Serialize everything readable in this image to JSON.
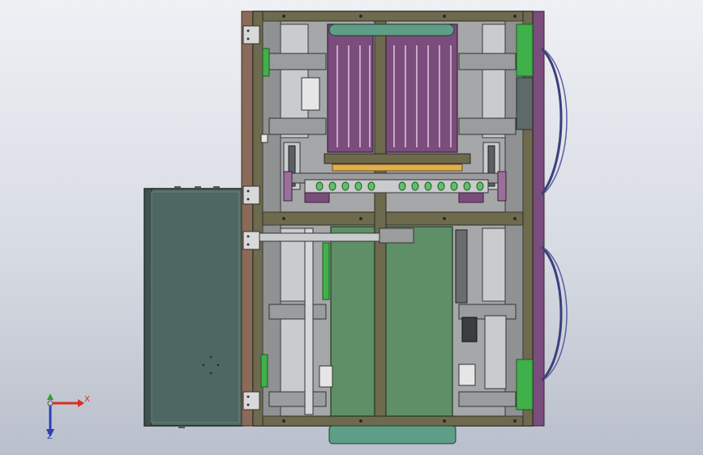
{
  "viewport": {
    "background_top": "#eef0f4",
    "background_bottom": "#b9bfcb"
  },
  "model": {
    "frame_color": "#6e6a4e",
    "frame_dark": "#4b4935",
    "plate_gray": "#a5a7a8",
    "panel_teal": "#4f6762",
    "green_plate": "#5f8f66",
    "bright_green": "#3fb04a",
    "purple": "#7a4d7c",
    "purple_light": "#9a6f9c",
    "orange": "#e0b050"
  },
  "triad": {
    "x_label": "X",
    "y_label": "Y",
    "z_label": "Z",
    "x_color": "#d83020",
    "y_color": "#2fa02f",
    "z_color": "#2a3fb8"
  }
}
